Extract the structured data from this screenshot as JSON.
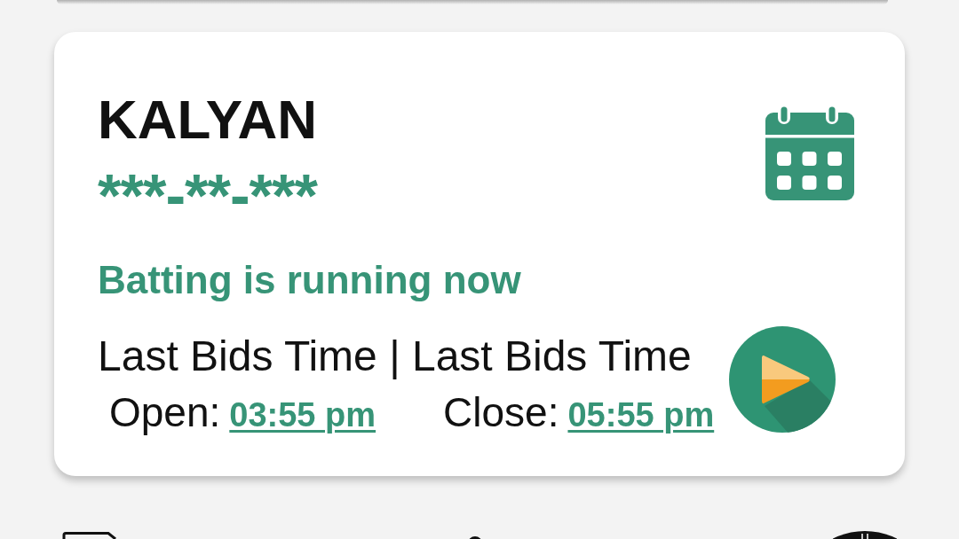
{
  "market": {
    "name": "KALYAN",
    "result": "***-**-***",
    "status": "Batting is running now",
    "bid_times_heading": "Last Bids Time | Last Bids Time",
    "open": {
      "label": "Open:",
      "time": "03:55 pm"
    },
    "close": {
      "label": "Close:",
      "time": "05:55 pm"
    }
  }
}
